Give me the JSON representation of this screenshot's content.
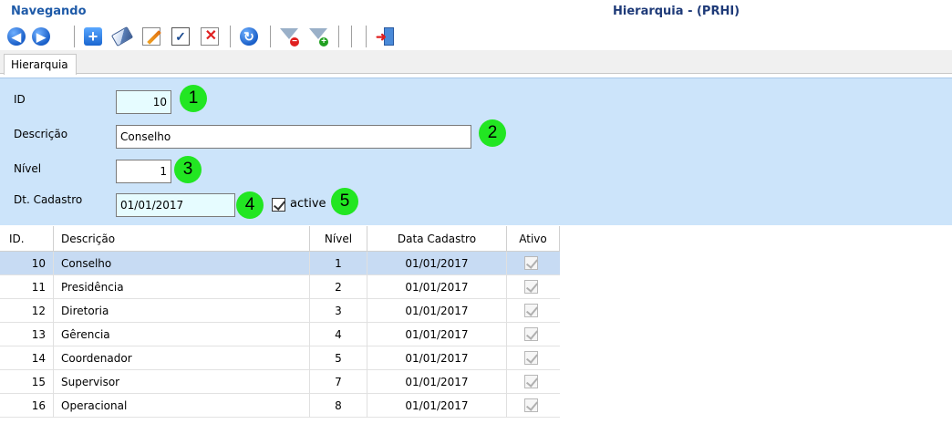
{
  "header": {
    "status": "Navegando",
    "title": "Hierarquia - (PRHI)"
  },
  "toolbar": {
    "buttons": [
      {
        "name": "back-button",
        "icon": "arrow-left-icon"
      },
      {
        "name": "forward-button",
        "icon": "arrow-right-icon"
      },
      {
        "name": "add-button",
        "icon": "plus-icon"
      },
      {
        "name": "clear-button",
        "icon": "eraser-icon"
      },
      {
        "name": "edit-button",
        "icon": "pencil-icon"
      },
      {
        "name": "confirm-button",
        "icon": "check-icon"
      },
      {
        "name": "delete-button",
        "icon": "delete-icon"
      },
      {
        "name": "refresh-button",
        "icon": "refresh-icon"
      },
      {
        "name": "filter-remove-button",
        "icon": "funnel-minus-icon"
      },
      {
        "name": "filter-add-button",
        "icon": "funnel-plus-icon"
      },
      {
        "name": "exit-button",
        "icon": "exit-door-icon"
      }
    ]
  },
  "tabs": [
    {
      "label": "Hierarquia"
    }
  ],
  "form": {
    "id_label": "ID",
    "id_value": "10",
    "descricao_label": "Descrição",
    "descricao_value": "Conselho",
    "nivel_label": "Nível",
    "nivel_value": "1",
    "dt_cadastro_label": "Dt. Cadastro",
    "dt_cadastro_value": "01/01/2017",
    "active_label": "active",
    "active_checked": true
  },
  "callouts": [
    "1",
    "2",
    "3",
    "4",
    "5"
  ],
  "colors": {
    "form_background": "#cce4fa",
    "callout": "#22e622",
    "selected_row": "#c7dbf3",
    "status_text": "#1e5aa8"
  },
  "table": {
    "columns": [
      "ID.",
      "Descrição",
      "Nível",
      "Data Cadastro",
      "Ativo"
    ],
    "rows": [
      {
        "id": "10",
        "descricao": "Conselho",
        "nivel": "1",
        "data": "01/01/2017",
        "ativo": true
      },
      {
        "id": "11",
        "descricao": "Presidência",
        "nivel": "2",
        "data": "01/01/2017",
        "ativo": true
      },
      {
        "id": "12",
        "descricao": "Diretoria",
        "nivel": "3",
        "data": "01/01/2017",
        "ativo": true
      },
      {
        "id": "13",
        "descricao": "Gêrencia",
        "nivel": "4",
        "data": "01/01/2017",
        "ativo": true
      },
      {
        "id": "14",
        "descricao": "Coordenador",
        "nivel": "5",
        "data": "01/01/2017",
        "ativo": true
      },
      {
        "id": "15",
        "descricao": "Supervisor",
        "nivel": "7",
        "data": "01/01/2017",
        "ativo": true
      },
      {
        "id": "16",
        "descricao": "Operacional",
        "nivel": "8",
        "data": "01/01/2017",
        "ativo": true
      }
    ]
  }
}
